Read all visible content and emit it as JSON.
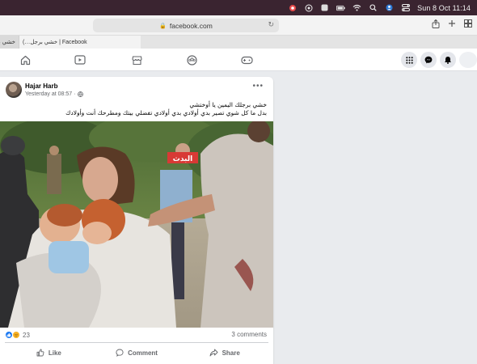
{
  "menubar": {
    "clock": "Sun 8 Oct  11:14",
    "icons": [
      "record-icon",
      "circle-dot-icon",
      "app-icon",
      "battery-icon",
      "wifi-icon",
      "search-icon",
      "user-icon",
      "control-center-icon"
    ]
  },
  "browser": {
    "url": "facebook.com",
    "tabs": [
      {
        "label": "خشي بر"
      },
      {
        "label": "(…خشي برجل | Facebook"
      },
      {
        "label": ""
      }
    ]
  },
  "post": {
    "author": "Hajar Harb",
    "timestamp": "Yesterday at 08:57 ·",
    "text_line1": "خشي برجلك اليمين يا أوختشي",
    "text_line2": "بدل ما كل شوي تصير بدي أولادي بدي أولادي تفضلي بيتك ومطرحك أنت وأولادك",
    "watermark": "البدث",
    "reaction_count": "23",
    "comments_count": "3 comments",
    "actions": {
      "like": "Like",
      "comment": "Comment",
      "share": "Share"
    }
  },
  "colors": {
    "menubar": "#3a2430",
    "fb_blue": "#1877f2",
    "page_bg": "#e9ebee",
    "muted": "#65676b"
  }
}
